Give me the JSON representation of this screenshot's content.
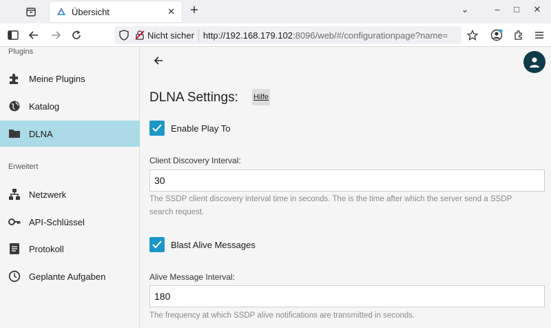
{
  "browser": {
    "tab_title": "Übersicht",
    "tab_close": "✕",
    "new_tab": "+",
    "window_controls": [
      "⌄",
      "–",
      "□",
      "✕"
    ],
    "security_label": "Nicht sicher",
    "url_host": "http://192.168.179.102",
    "url_rest": ":8096/web/#/configurationpage?name="
  },
  "sidebar": {
    "plugins_header": "Plugins",
    "items_plugins": [
      {
        "label": "Meine Plugins",
        "icon": "puzzle-icon"
      },
      {
        "label": "Katalog",
        "icon": "globe-icon"
      },
      {
        "label": "DLNA",
        "icon": "folder-icon",
        "active": true
      }
    ],
    "advanced_header": "Erweitert",
    "items_advanced": [
      {
        "label": "Netzwerk",
        "icon": "network-icon"
      },
      {
        "label": "API-Schlüssel",
        "icon": "key-icon"
      },
      {
        "label": "Protokoll",
        "icon": "log-icon"
      },
      {
        "label": "Geplante Aufgaben",
        "icon": "clock-icon"
      }
    ]
  },
  "main": {
    "title": "DLNA Settings:",
    "help_button": "Hilfe",
    "enable_play_to": {
      "label": "Enable Play To",
      "checked": true
    },
    "client_discovery": {
      "label": "Client Discovery Interval:",
      "value": "30",
      "help": "The SSDP client discovery interval time in seconds. The is the time after which the server send a SSDP search request."
    },
    "blast_alive": {
      "label": "Blast Alive Messages",
      "checked": true
    },
    "alive_interval": {
      "label": "Alive Message Interval:",
      "value": "180",
      "help": "The frequency at which SSDP alive notifications are transmitted in seconds."
    }
  },
  "colors": {
    "accent": "#1d97c8",
    "active_nav": "#aadbe6",
    "avatar": "#0e3a4a"
  }
}
